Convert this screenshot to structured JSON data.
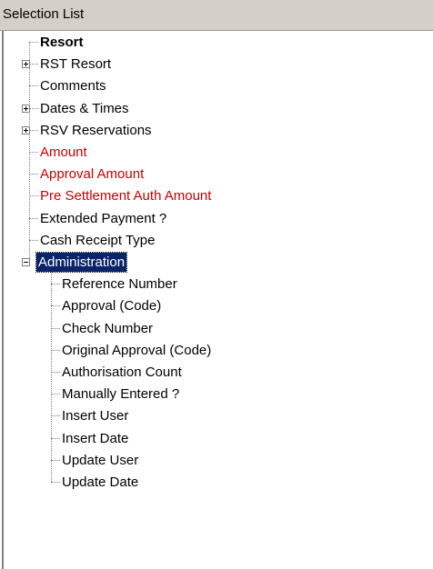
{
  "header": {
    "title": "Selection List"
  },
  "tree": {
    "root_label": "Resort",
    "items": [
      {
        "label": "RST  Resort",
        "expander": "plus",
        "color": "black"
      },
      {
        "label": "Comments",
        "expander": "none",
        "color": "black"
      },
      {
        "label": "Dates & Times",
        "expander": "plus",
        "color": "black"
      },
      {
        "label": "RSV  Reservations",
        "expander": "plus",
        "color": "black"
      },
      {
        "label": "Amount",
        "expander": "none",
        "color": "#cc0000"
      },
      {
        "label": "Approval Amount",
        "expander": "none",
        "color": "#cc0000"
      },
      {
        "label": "Pre Settlement Auth Amount",
        "expander": "none",
        "color": "#cc0000"
      },
      {
        "label": "Extended Payment ?",
        "expander": "none",
        "color": "black"
      },
      {
        "label": "Cash Receipt Type",
        "expander": "none",
        "color": "black"
      },
      {
        "label": "Administration",
        "expander": "minus",
        "color": "black",
        "selected": true
      }
    ],
    "admin_children": [
      "Reference Number",
      "Approval (Code)",
      "Check Number",
      "Original Approval (Code)",
      "Authorisation Count",
      "Manually Entered ?",
      "Insert User",
      "Insert Date",
      "Update User",
      "Update Date"
    ]
  },
  "colors": {
    "selection_bg": "#0a246a",
    "red_text": "#cc0000",
    "header_bg": "#d4d0c8"
  }
}
